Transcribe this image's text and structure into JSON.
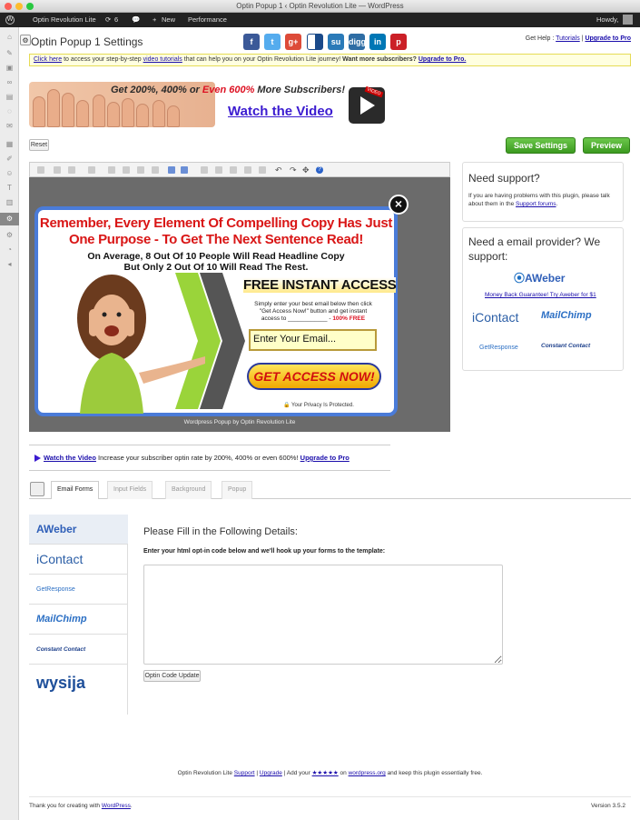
{
  "window": {
    "title": "Optin Popup 1 ‹ Optin Revolution Lite — WordPress"
  },
  "adminbar": {
    "site": "Optin Revolution Lite",
    "updates": "6",
    "new": "New",
    "performance": "Performance",
    "howdy": "Howdy,"
  },
  "header": {
    "title": "Optin Popup 1 Settings",
    "help_prefix": "Get Help :",
    "tutorials": "Tutorials",
    "upgrade": "Upgrade to Pro",
    "social": [
      "f",
      "t",
      "g+",
      "",
      "su",
      "digg",
      "in",
      "p"
    ],
    "social_colors": [
      "#3b5998",
      "#55acee",
      "#dd4b39",
      "#1a4a8a",
      "#2a7ab8",
      "#2e6da4",
      "#0077b5",
      "#cb2027"
    ]
  },
  "notice": {
    "link1": "Click here",
    "t1": " to access your step-by-step ",
    "link2": "video tutorials",
    "t2": " that can help you on your Optin Revolution Lite journey! ",
    "bold": "Want more subscribers?",
    "link3": "Upgrade to Pro."
  },
  "banner": {
    "headline_a": "Get 200%, 400% or ",
    "headline_b": "Even 600%",
    "headline_c": " More Subscribers!",
    "watch": "Watch the Video",
    "video_badge": "VIDEO"
  },
  "buttons": {
    "reset": "Reset",
    "save": "Save Settings",
    "preview": "Preview"
  },
  "popup": {
    "headline1": "Remember, Every Element Of Compelling Copy Has Just",
    "headline2": "One Purpose - To Get The Next Sentence Read!",
    "sub1": "On Average, 8 Out Of 10 People Will Read Headline Copy",
    "sub2": "But Only 2 Out Of 10 Will Read The Rest.",
    "cta_title": "FREE INSTANT ACCESS",
    "instructions1": "Simply enter your best email below then click",
    "instructions2": "\"Get Access Now!\" button and get instant",
    "instructions3": "access to ____________ - ",
    "free": "100% FREE",
    "email_placeholder": "Enter Your Email...",
    "submit": "GET ACCESS NOW!",
    "privacy": "Your Privacy Is Protected.",
    "close": "×",
    "credit": "Wordpress Popup by Optin Revolution Lite"
  },
  "support": {
    "title": "Need support?",
    "text": "If you are having problems with this plugin, please talk about them in the ",
    "link": "Support forums",
    "end": "."
  },
  "providers_panel": {
    "title": "Need a email provider? We support:",
    "aweber_link": "Money Back Guarantee! Try Aweber for $1",
    "logos": [
      "AWeber",
      "iContact",
      "MailChimp",
      "GetResponse",
      "Constant Contact"
    ]
  },
  "video_line": {
    "link": "Watch the Video",
    "text": " Increase your subscriber optin rate by 200%, 400% or even 600%! ",
    "upgrade": "Upgrade to Pro"
  },
  "tabs": [
    "Email Forms",
    "Input Fields",
    "Background",
    "Popup"
  ],
  "email_forms": {
    "providers": [
      "AWeber",
      "iContact",
      "GetResponse",
      "MailChimp",
      "Constant Contact",
      "wysija"
    ],
    "heading": "Please Fill in the Following Details:",
    "subheading": "Enter your html opt-in code below and we'll hook up your forms to the template:",
    "textarea_value": "",
    "update_button": "Optin Code Update"
  },
  "footer": {
    "t1": "Optin Revolution Lite ",
    "support": "Support",
    "sep": " | ",
    "upgrade": "Upgrade",
    "t2": " | Add your ",
    "stars": "★★★★★",
    "t3": " on ",
    "wp": "wordpress.org",
    "t4": " and keep this plugin essentially free.",
    "thanks_a": "Thank you for creating with ",
    "thanks_link": "WordPress",
    "thanks_b": ".",
    "version": "Version 3.5.2"
  }
}
